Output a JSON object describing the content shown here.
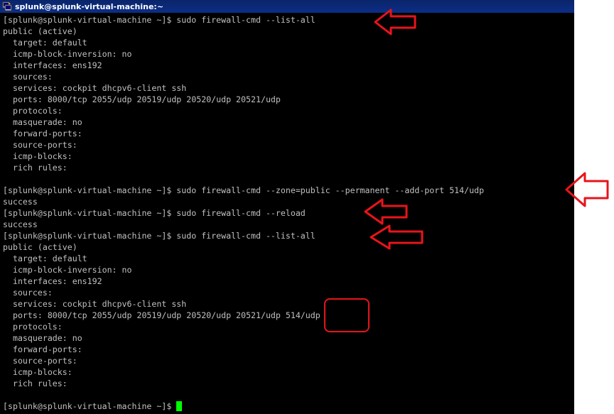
{
  "window": {
    "title": "splunk@splunk-virtual-machine:~",
    "icon": "putty-terminal-icon"
  },
  "terminal": {
    "lines": [
      "[splunk@splunk-virtual-machine ~]$ sudo firewall-cmd --list-all",
      "public (active)",
      "  target: default",
      "  icmp-block-inversion: no",
      "  interfaces: ens192",
      "  sources:",
      "  services: cockpit dhcpv6-client ssh",
      "  ports: 8000/tcp 2055/udp 20519/udp 20520/udp 20521/udp",
      "  protocols:",
      "  masquerade: no",
      "  forward-ports:",
      "  source-ports:",
      "  icmp-blocks:",
      "  rich rules:",
      "",
      "[splunk@splunk-virtual-machine ~]$ sudo firewall-cmd --zone=public --permanent --add-port 514/udp",
      "success",
      "[splunk@splunk-virtual-machine ~]$ sudo firewall-cmd --reload",
      "success",
      "[splunk@splunk-virtual-machine ~]$ sudo firewall-cmd --list-all",
      "public (active)",
      "  target: default",
      "  icmp-block-inversion: no",
      "  interfaces: ens192",
      "  sources:",
      "  services: cockpit dhcpv6-client ssh",
      "  ports: 8000/tcp 2055/udp 20519/udp 20520/udp 20521/udp 514/udp",
      "  protocols:",
      "  masquerade: no",
      "  forward-ports:",
      "  source-ports:",
      "  icmp-blocks:",
      "  rich rules:",
      "",
      "[splunk@splunk-virtual-machine ~]$ "
    ],
    "fg_color": "#c0c0c0",
    "bg_color": "#000000",
    "cursor_color": "#00ff00"
  },
  "annotations": {
    "color": "#e8141b",
    "arrows": [
      "left-arrow",
      "left-arrow",
      "left-arrow",
      "left-arrow"
    ],
    "highlight": "514/udp"
  }
}
